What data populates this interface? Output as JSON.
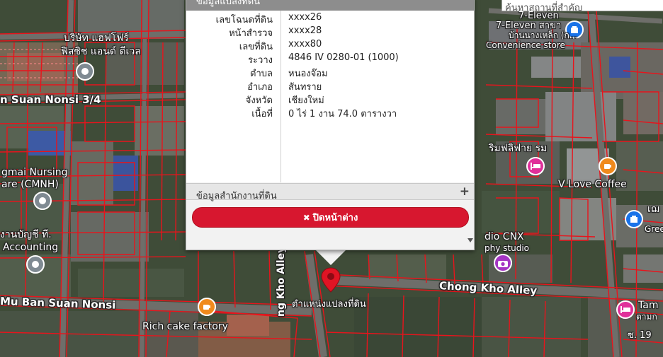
{
  "search": {
    "placeholder": "ค้นหาสถานที่สำคัญ"
  },
  "popup": {
    "title": "ข้อมูลแปลงที่ดิน",
    "rows": [
      {
        "label": "เลขโฉนดที่ดิน",
        "value": "xxxx26"
      },
      {
        "label": "หน้าสำรวจ",
        "value": "xxxx28"
      },
      {
        "label": "เลขที่ดิน",
        "value": "xxxx80"
      },
      {
        "label": "ระวาง",
        "value": "4846 IV 0280-01 (1000)"
      },
      {
        "label": "ตำบล",
        "value": "หนองจ๊อม"
      },
      {
        "label": "อำเภอ",
        "value": "สันทราย"
      },
      {
        "label": "จังหวัด",
        "value": "เชียงใหม่"
      },
      {
        "label": "เนื้อที่",
        "value": "0 ไร่ 1 งาน 74.0 ตารางวา"
      }
    ],
    "office_section_label": "ข้อมูลสำนักงานที่ดิน",
    "expand_symbol": "+",
    "close_button_label": "ปิดหน้าต่าง",
    "close_icon": "✖"
  },
  "map": {
    "marker_label": "ตำแหน่งแปลงที่ดิน",
    "labels": {
      "company_line1": "บริษัท แฮฟโฟร์",
      "company_line2": "ฟิสซิช แอนด์ ดีเวล",
      "suan_nonsi": "n Suan Nonsi 3/4",
      "nursing_line1": "gmai Nursing",
      "nursing_line2": "are (CMNH)",
      "accounting_line1": "งานบัญชี ที.",
      "accounting_line2": "Accounting",
      "mu_ban": "Mu Ban Suan Nonsi",
      "rich_cake": "Rich cake factory",
      "kho_alley": "ng Kho Alley",
      "chong_kho": "Chong Kho Alley",
      "seven_line1": "7-Eleven",
      "seven_line2": "7-Eleven สาขา",
      "seven_line3": "บ้านนางเหล็ก (ก...",
      "seven_line4": "Convenience store",
      "rim": "ริมฟลิฟาย รม",
      "vlove": "V Love Coffee",
      "dio_line1": "dio CNX",
      "dio_line2": "phy studio",
      "gree_line1": "เฌ",
      "gree_line2": "Gree",
      "tam_line1": "Tam",
      "tam_line2": "ตามก",
      "soi": "ซ. 19"
    },
    "icons": {
      "poi_grey": "location-dot-icon",
      "poi_blue": "store-icon",
      "poi_pink": "hotel-icon",
      "poi_orange": "cafe-icon",
      "poi_purple": "camera-icon",
      "pin": "map-pin-icon"
    },
    "colors": {
      "parcel_line": "#e8141c",
      "close_button": "#d7172f",
      "popup_header": "#8d8d8d"
    }
  }
}
